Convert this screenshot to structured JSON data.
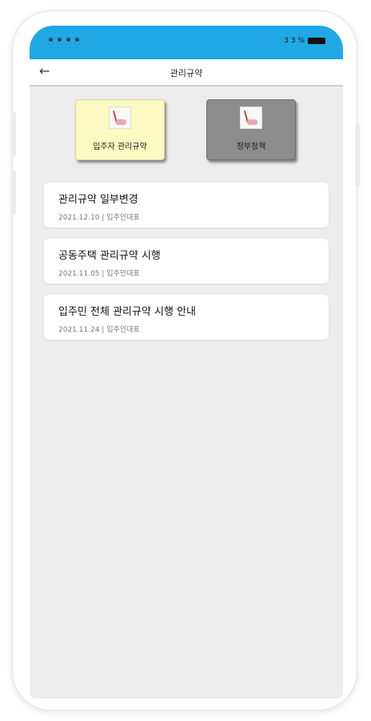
{
  "status_bar": {
    "left_text": "",
    "right_text": "3 3 %",
    "color": "#1fa8e4"
  },
  "header": {
    "back_icon": "←",
    "title": "관리규약"
  },
  "tiles": [
    {
      "label": "입주자 관리규약",
      "icon": "document-icon",
      "color": "#fafac2"
    },
    {
      "label": "정부정책",
      "icon": "document-icon",
      "color": "#8d8d8d"
    }
  ],
  "posts": [
    {
      "title": "관리규약 일부변경",
      "date": "2021.12.10",
      "author": "입주인대표"
    },
    {
      "title": "공동주택 관리규약 시행",
      "date": "2021.11.05",
      "author": "입주민대표"
    },
    {
      "title": "입주민 전체 관리규약 시행 안내",
      "date": "2021.11.24",
      "author": "입주인대표"
    }
  ],
  "meta_separator": " | "
}
